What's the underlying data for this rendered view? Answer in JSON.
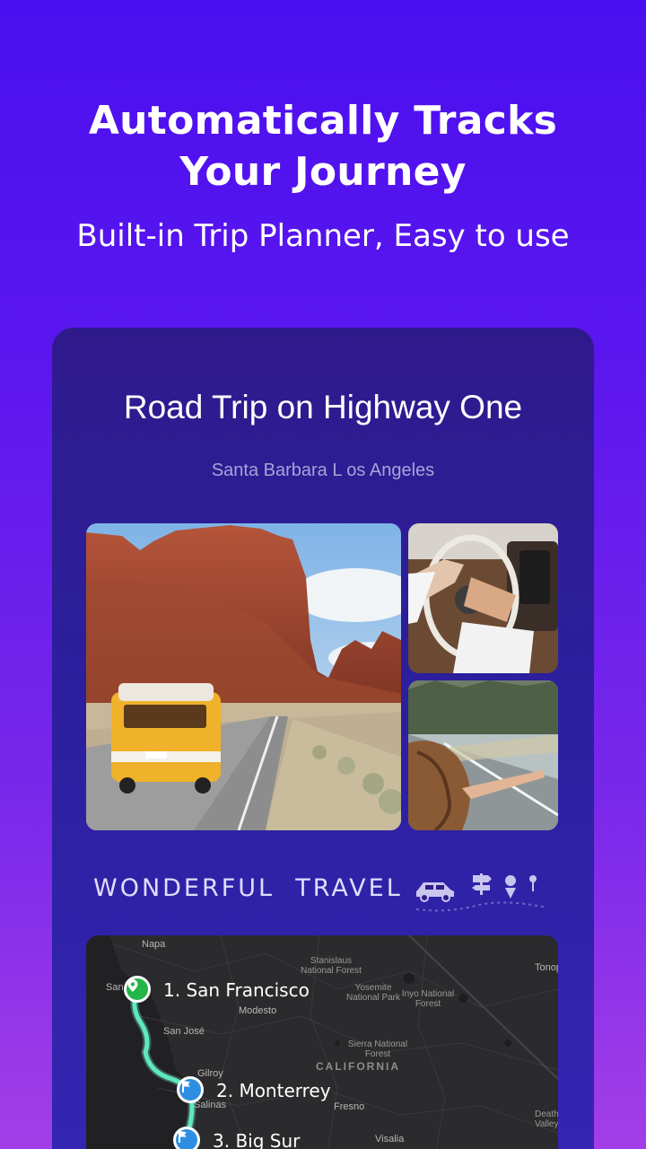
{
  "header": {
    "title_line1": "Automatically Tracks",
    "title_line2": "Your Journey",
    "subtitle": "Built-in Trip Planner, Easy to use"
  },
  "card": {
    "title": "Road Trip on Highway One",
    "route": "Santa Barbara L os Angeles",
    "section_heading": "WONDERFUL  TRAVEL"
  },
  "map": {
    "labels": {
      "napa": "Napa",
      "san": "San",
      "stanislaus": "Stanislaus",
      "national_forest": "National Forest",
      "yosemite": "Yosemite",
      "national_park": "National Park",
      "inyo": "Inyo National",
      "forest": "Forest",
      "tonop": "Tonop",
      "modesto": "Modesto",
      "san_jose": "San José",
      "sierra": "Sierra National",
      "forest2": "Forest",
      "california": "CALIFORNIA",
      "gilroy": "Gilroy",
      "salinas": "Salinas",
      "fresno": "Fresno",
      "death": "Death",
      "valley": "Valley",
      "visalia": "Visalia"
    },
    "stops": [
      {
        "label": "1. San Francisco",
        "icon": "location-pin-icon",
        "color": "#22b548"
      },
      {
        "label": "2. Monterrey",
        "icon": "flag-icon",
        "color": "#2e8ee2"
      },
      {
        "label": "3. Big Sur",
        "icon": "flag-icon",
        "color": "#2e8ee2"
      }
    ],
    "route_color": "#5ee8c0"
  },
  "colors": {
    "background_top": "#4a0ff0",
    "background_bottom": "#a33ee8",
    "card": "#2f1a8c"
  }
}
